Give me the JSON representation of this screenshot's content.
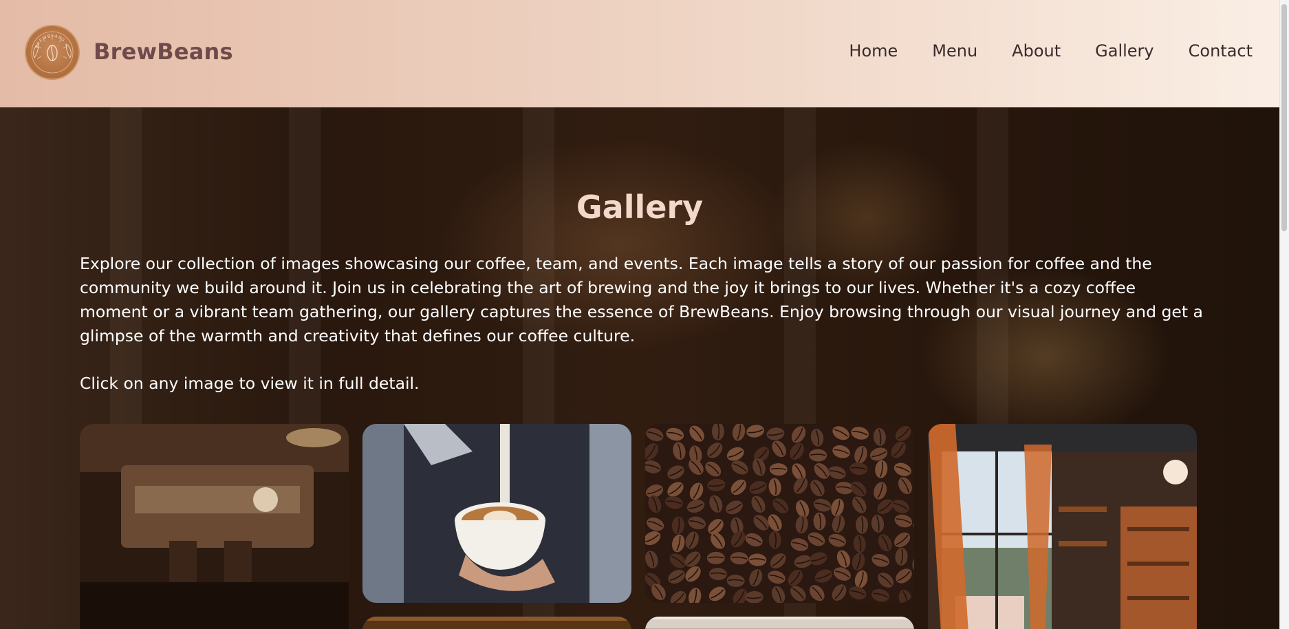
{
  "header": {
    "brand": "BrewBeans",
    "logo_text": "BREWBEANS",
    "nav": [
      "Home",
      "Menu",
      "About",
      "Gallery",
      "Contact"
    ]
  },
  "gallery": {
    "title": "Gallery",
    "intro": "Explore our collection of images showcasing our coffee, team, and events. Each image tells a story of our passion for coffee and the community we build around it. Join us in celebrating the art of brewing and the joy it brings to our lives. Whether it's a cozy coffee moment or a vibrant team gathering, our gallery captures the essence of BrewBeans. Enjoy browsing through our visual journey and get a glimpse of the warmth and creativity that defines our coffee culture.",
    "hint": "Click on any image to view it in full detail."
  },
  "colors": {
    "header_start": "#e4bba6",
    "header_end": "#faeee4",
    "brand_text": "#6e4a4a",
    "title_text": "#f2d9c9",
    "logo_fill": "#b3713f"
  }
}
